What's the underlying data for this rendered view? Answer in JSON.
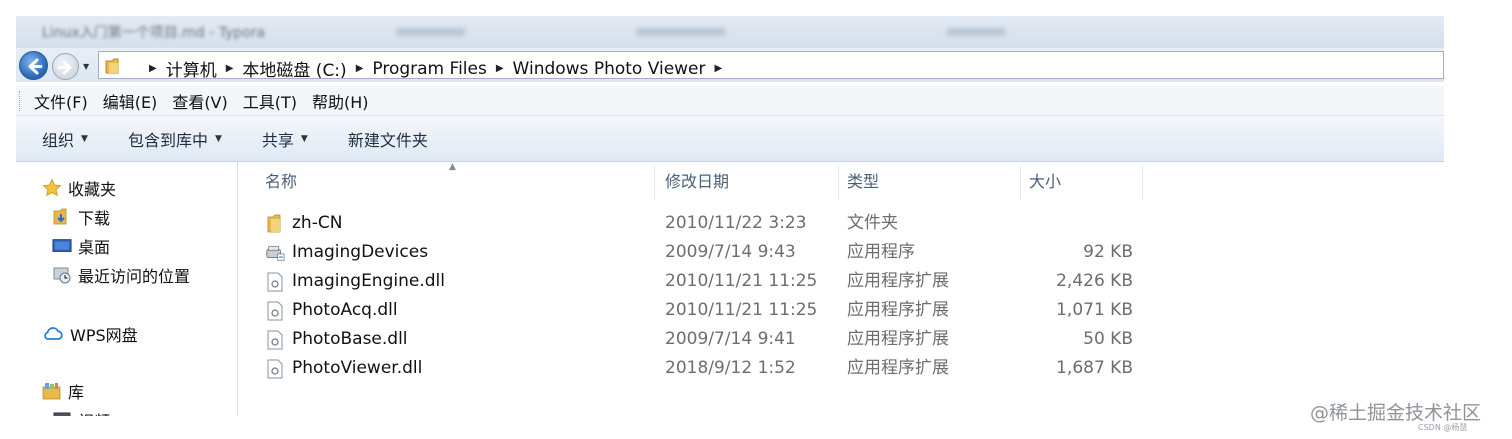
{
  "title_bar": {
    "title": "Linux入门第一个项目.md - Typora"
  },
  "address_bar": {
    "breadcrumbs": [
      "计算机",
      "本地磁盘 (C:)",
      "Program Files",
      "Windows Photo Viewer"
    ]
  },
  "menu": [
    "文件(F)",
    "编辑(E)",
    "查看(V)",
    "工具(T)",
    "帮助(H)"
  ],
  "toolbar": {
    "organize": "组织",
    "include_in_library": "包含到库中",
    "share": "共享",
    "new_folder": "新建文件夹"
  },
  "nav_pane": {
    "favorites": "收藏夹",
    "downloads": "下载",
    "desktop": "桌面",
    "recent": "最近访问的位置",
    "wps": "WPS网盘",
    "libraries": "库",
    "videos": "视频"
  },
  "columns": {
    "name": "名称",
    "date": "修改日期",
    "type": "类型",
    "size": "大小"
  },
  "files": [
    {
      "name": "zh-CN",
      "date": "2010/11/22 3:23",
      "type": "文件夹",
      "size": "",
      "icon": "folder-icon"
    },
    {
      "name": "ImagingDevices",
      "date": "2009/7/14 9:43",
      "type": "应用程序",
      "size": "92 KB",
      "icon": "application-icon"
    },
    {
      "name": "ImagingEngine.dll",
      "date": "2010/11/21 11:25",
      "type": "应用程序扩展",
      "size": "2,426 KB",
      "icon": "dll-file-icon"
    },
    {
      "name": "PhotoAcq.dll",
      "date": "2010/11/21 11:25",
      "type": "应用程序扩展",
      "size": "1,071 KB",
      "icon": "dll-file-icon"
    },
    {
      "name": "PhotoBase.dll",
      "date": "2009/7/14 9:41",
      "type": "应用程序扩展",
      "size": "50 KB",
      "icon": "dll-file-icon"
    },
    {
      "name": "PhotoViewer.dll",
      "date": "2018/9/12 1:52",
      "type": "应用程序扩展",
      "size": "1,687 KB",
      "icon": "dll-file-icon"
    }
  ],
  "watermark": "@稀土掘金技术社区",
  "watermark_small": "CSDN @杨慧",
  "colors": {
    "accent": "#2d6fbf",
    "folder": "#e8b84a"
  }
}
